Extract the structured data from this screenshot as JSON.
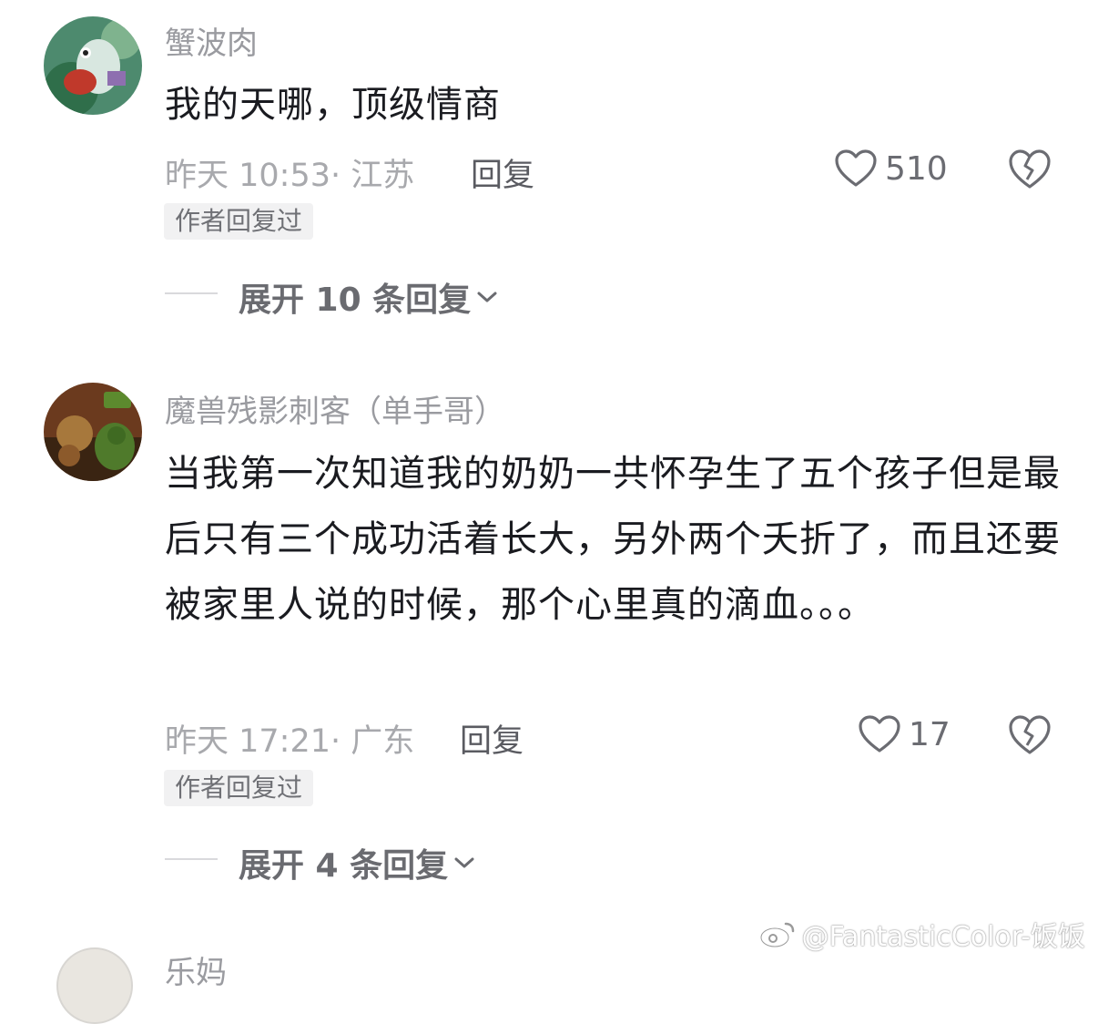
{
  "comments": [
    {
      "username": "蟹波肉",
      "text": "我的天哪，顶级情商",
      "meta": "昨天 10:53· 江苏",
      "reply_label": "回复",
      "like_count": "510",
      "badge": "作者回复过",
      "expand_label": "展开 10 条回复"
    },
    {
      "username": "魔兽残影刺客（单手哥）",
      "text": "当我第一次知道我的奶奶一共怀孕生了五个孩子但是最后只有三个成功活着长大，另外两个夭折了，而且还要被家里人说的时候，那个心里真的滴血。。。",
      "meta": "昨天 17:21· 广东",
      "reply_label": "回复",
      "like_count": "17",
      "badge": "作者回复过",
      "expand_label": "展开 4 条回复"
    }
  ],
  "next_comment": {
    "username": "乐妈"
  },
  "watermark": "@FantasticColor-饭饭",
  "icons": [
    "heart-icon",
    "broken-heart-icon",
    "chevron-down-icon",
    "weibo-icon"
  ]
}
